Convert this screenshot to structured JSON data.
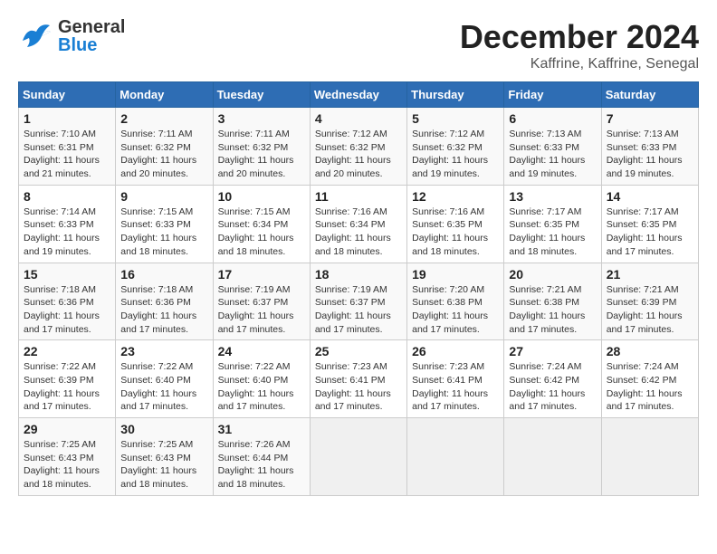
{
  "header": {
    "logo": {
      "general": "General",
      "blue": "Blue"
    },
    "month": "December 2024",
    "location": "Kaffrine, Kaffrine, Senegal"
  },
  "weekdays": [
    "Sunday",
    "Monday",
    "Tuesday",
    "Wednesday",
    "Thursday",
    "Friday",
    "Saturday"
  ],
  "weeks": [
    [
      {
        "day": 1,
        "sunrise": "7:10 AM",
        "sunset": "6:31 PM",
        "daylight": "11 hours and 21 minutes."
      },
      {
        "day": 2,
        "sunrise": "7:11 AM",
        "sunset": "6:32 PM",
        "daylight": "11 hours and 20 minutes."
      },
      {
        "day": 3,
        "sunrise": "7:11 AM",
        "sunset": "6:32 PM",
        "daylight": "11 hours and 20 minutes."
      },
      {
        "day": 4,
        "sunrise": "7:12 AM",
        "sunset": "6:32 PM",
        "daylight": "11 hours and 20 minutes."
      },
      {
        "day": 5,
        "sunrise": "7:12 AM",
        "sunset": "6:32 PM",
        "daylight": "11 hours and 19 minutes."
      },
      {
        "day": 6,
        "sunrise": "7:13 AM",
        "sunset": "6:33 PM",
        "daylight": "11 hours and 19 minutes."
      },
      {
        "day": 7,
        "sunrise": "7:13 AM",
        "sunset": "6:33 PM",
        "daylight": "11 hours and 19 minutes."
      }
    ],
    [
      {
        "day": 8,
        "sunrise": "7:14 AM",
        "sunset": "6:33 PM",
        "daylight": "11 hours and 19 minutes."
      },
      {
        "day": 9,
        "sunrise": "7:15 AM",
        "sunset": "6:33 PM",
        "daylight": "11 hours and 18 minutes."
      },
      {
        "day": 10,
        "sunrise": "7:15 AM",
        "sunset": "6:34 PM",
        "daylight": "11 hours and 18 minutes."
      },
      {
        "day": 11,
        "sunrise": "7:16 AM",
        "sunset": "6:34 PM",
        "daylight": "11 hours and 18 minutes."
      },
      {
        "day": 12,
        "sunrise": "7:16 AM",
        "sunset": "6:35 PM",
        "daylight": "11 hours and 18 minutes."
      },
      {
        "day": 13,
        "sunrise": "7:17 AM",
        "sunset": "6:35 PM",
        "daylight": "11 hours and 18 minutes."
      },
      {
        "day": 14,
        "sunrise": "7:17 AM",
        "sunset": "6:35 PM",
        "daylight": "11 hours and 17 minutes."
      }
    ],
    [
      {
        "day": 15,
        "sunrise": "7:18 AM",
        "sunset": "6:36 PM",
        "daylight": "11 hours and 17 minutes."
      },
      {
        "day": 16,
        "sunrise": "7:18 AM",
        "sunset": "6:36 PM",
        "daylight": "11 hours and 17 minutes."
      },
      {
        "day": 17,
        "sunrise": "7:19 AM",
        "sunset": "6:37 PM",
        "daylight": "11 hours and 17 minutes."
      },
      {
        "day": 18,
        "sunrise": "7:19 AM",
        "sunset": "6:37 PM",
        "daylight": "11 hours and 17 minutes."
      },
      {
        "day": 19,
        "sunrise": "7:20 AM",
        "sunset": "6:38 PM",
        "daylight": "11 hours and 17 minutes."
      },
      {
        "day": 20,
        "sunrise": "7:21 AM",
        "sunset": "6:38 PM",
        "daylight": "11 hours and 17 minutes."
      },
      {
        "day": 21,
        "sunrise": "7:21 AM",
        "sunset": "6:39 PM",
        "daylight": "11 hours and 17 minutes."
      }
    ],
    [
      {
        "day": 22,
        "sunrise": "7:22 AM",
        "sunset": "6:39 PM",
        "daylight": "11 hours and 17 minutes."
      },
      {
        "day": 23,
        "sunrise": "7:22 AM",
        "sunset": "6:40 PM",
        "daylight": "11 hours and 17 minutes."
      },
      {
        "day": 24,
        "sunrise": "7:22 AM",
        "sunset": "6:40 PM",
        "daylight": "11 hours and 17 minutes."
      },
      {
        "day": 25,
        "sunrise": "7:23 AM",
        "sunset": "6:41 PM",
        "daylight": "11 hours and 17 minutes."
      },
      {
        "day": 26,
        "sunrise": "7:23 AM",
        "sunset": "6:41 PM",
        "daylight": "11 hours and 17 minutes."
      },
      {
        "day": 27,
        "sunrise": "7:24 AM",
        "sunset": "6:42 PM",
        "daylight": "11 hours and 17 minutes."
      },
      {
        "day": 28,
        "sunrise": "7:24 AM",
        "sunset": "6:42 PM",
        "daylight": "11 hours and 17 minutes."
      }
    ],
    [
      {
        "day": 29,
        "sunrise": "7:25 AM",
        "sunset": "6:43 PM",
        "daylight": "11 hours and 18 minutes."
      },
      {
        "day": 30,
        "sunrise": "7:25 AM",
        "sunset": "6:43 PM",
        "daylight": "11 hours and 18 minutes."
      },
      {
        "day": 31,
        "sunrise": "7:26 AM",
        "sunset": "6:44 PM",
        "daylight": "11 hours and 18 minutes."
      },
      null,
      null,
      null,
      null
    ]
  ]
}
